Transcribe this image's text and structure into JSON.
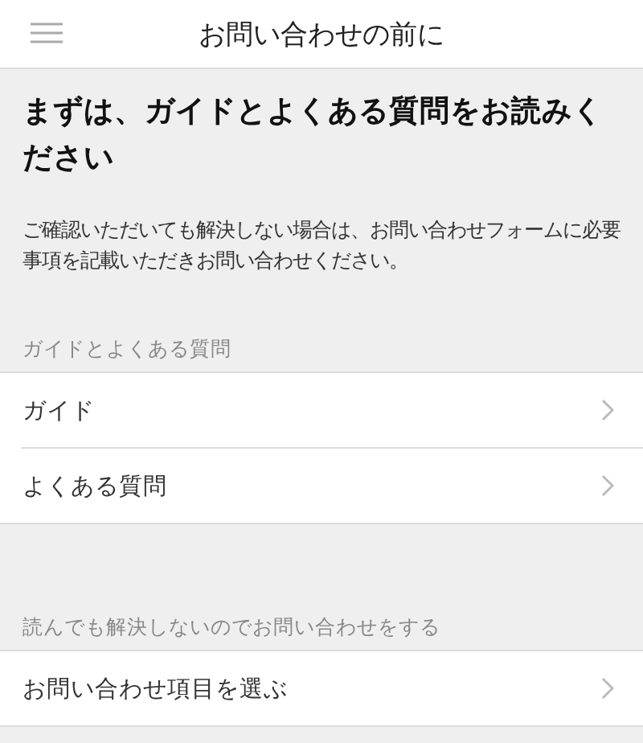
{
  "header": {
    "title": "お問い合わせの前に"
  },
  "intro": {
    "heading": "まずは、ガイドとよくある質問をお読みください",
    "body": "ご確認いただいても解決しない場合は、お問い合わせフォームに必要事項を記載いただきお問い合わせください。"
  },
  "sections": [
    {
      "title": "ガイドとよくある質問",
      "items": [
        {
          "label": "ガイド"
        },
        {
          "label": "よくある質問"
        }
      ]
    },
    {
      "title": "読んでも解決しないのでお問い合わせをする",
      "items": [
        {
          "label": "お問い合わせ項目を選ぶ"
        }
      ]
    }
  ]
}
